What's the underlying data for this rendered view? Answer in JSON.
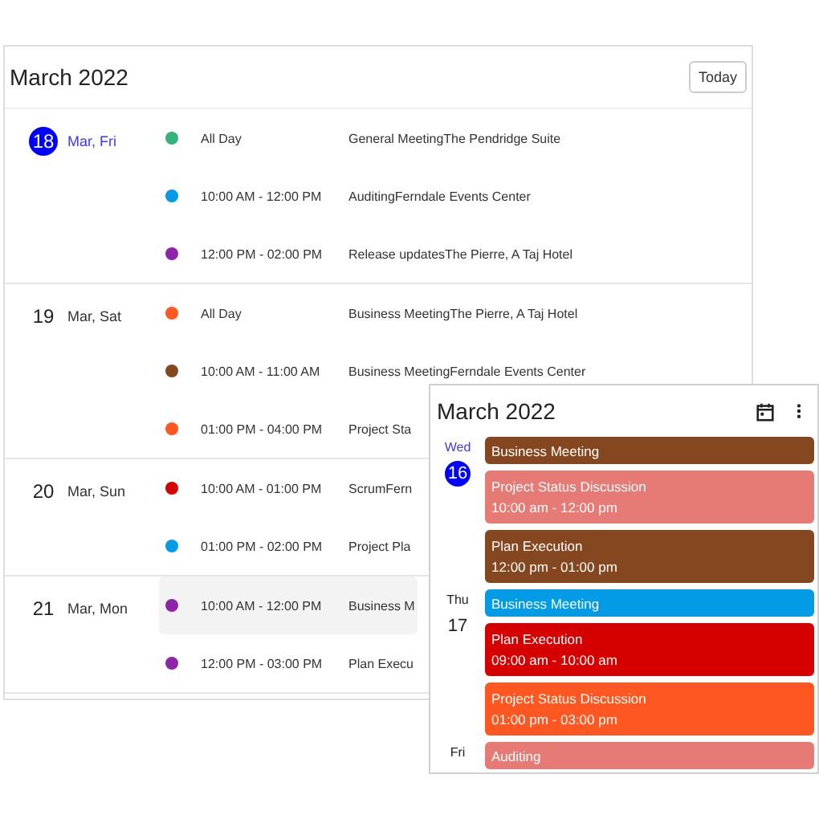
{
  "agenda": {
    "title": "March 2022",
    "today_button": "Today",
    "days": [
      {
        "number": "18",
        "label": "Mar, Fri",
        "today": true,
        "events": [
          {
            "color": "#33b27a",
            "time": "All Day",
            "title": "General MeetingThe Pendridge Suite",
            "highlighted": false
          },
          {
            "color": "#039be5",
            "time": "10:00 AM - 12:00 PM",
            "title": "AuditingFerndale Events Center",
            "highlighted": false
          },
          {
            "color": "#8e24aa",
            "time": "12:00 PM - 02:00 PM",
            "title": "Release updatesThe Pierre, A Taj Hotel",
            "highlighted": false
          }
        ]
      },
      {
        "number": "19",
        "label": "Mar, Sat",
        "today": false,
        "events": [
          {
            "color": "#ff5722",
            "time": "All Day",
            "title": "Business MeetingThe Pierre, A Taj Hotel",
            "highlighted": false
          },
          {
            "color": "#85471f",
            "time": "10:00 AM - 11:00 AM",
            "title": "Business MeetingFerndale Events Center",
            "highlighted": false
          },
          {
            "color": "#ff5722",
            "time": "01:00 PM - 04:00 PM",
            "title": "Project Sta",
            "highlighted": false
          }
        ]
      },
      {
        "number": "20",
        "label": "Mar, Sun",
        "today": false,
        "events": [
          {
            "color": "#d50000",
            "time": "10:00 AM - 01:00 PM",
            "title": "ScrumFern",
            "highlighted": false
          },
          {
            "color": "#039be5",
            "time": "01:00 PM - 02:00 PM",
            "title": "Project Pla",
            "highlighted": false
          }
        ]
      },
      {
        "number": "21",
        "label": "Mar, Mon",
        "today": false,
        "events": [
          {
            "color": "#8e24aa",
            "time": "10:00 AM - 12:00 PM",
            "title": "Business M",
            "highlighted": true
          },
          {
            "color": "#8e24aa",
            "time": "12:00 PM - 03:00 PM",
            "title": "Plan Execu",
            "highlighted": false
          }
        ]
      }
    ]
  },
  "mobile": {
    "title": "March 2022",
    "days": [
      {
        "weekday": "Wed",
        "number": "16",
        "today": true,
        "events": [
          {
            "title": "Business Meeting",
            "color": "#85471f"
          },
          {
            "title": "Project Status Discussion",
            "time": "10:00 am - 12:00 pm",
            "color": "#e57b74"
          },
          {
            "title": "Plan Execution",
            "time": "12:00 pm - 01:00 pm",
            "color": "#85471f"
          }
        ]
      },
      {
        "weekday": "Thu",
        "number": "17",
        "today": false,
        "events": [
          {
            "title": "Business Meeting",
            "color": "#039be5"
          },
          {
            "title": "Plan Execution",
            "time": "09:00 am - 10:00 am",
            "color": "#d50000"
          },
          {
            "title": "Project Status Discussion",
            "time": "01:00 pm - 03:00 pm",
            "color": "#ff5722"
          }
        ]
      },
      {
        "weekday": "Fri",
        "today": false,
        "events": [
          {
            "title": "Auditing",
            "color": "#e57b74"
          }
        ]
      }
    ]
  }
}
